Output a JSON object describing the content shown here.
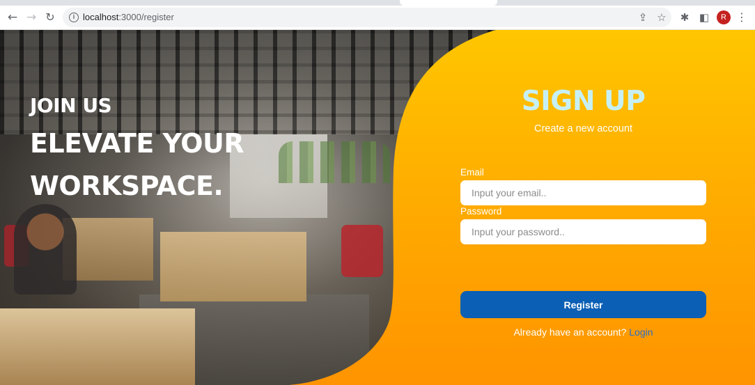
{
  "browser": {
    "url_host": "localhost",
    "url_path": ":3000/register",
    "profile_initial": "R",
    "icons": {
      "back": "back-arrow-icon",
      "forward": "forward-arrow-icon",
      "reload": "reload-icon",
      "site_info": "info-icon",
      "share": "share-icon",
      "bookmark": "star-icon",
      "extensions": "puzzle-icon",
      "side_panel": "side-panel-icon",
      "menu": "kebab-menu-icon"
    }
  },
  "hero": {
    "join": "JOIN US",
    "line1": "ELEVATE YOUR",
    "line2": "WORKSPACE."
  },
  "form": {
    "title": "SIGN UP",
    "subtitle": "Create a new account",
    "email_label": "Email",
    "email_placeholder": "Input your email..",
    "email_value": "",
    "password_label": "Password",
    "password_placeholder": "Input your password..",
    "password_value": "",
    "register_label": "Register",
    "login_prompt": "Already have an account?",
    "login_link": "Login"
  },
  "colors": {
    "panel_top": "#ffc600",
    "panel_bottom": "#ff9a00",
    "title": "#c7f0f5",
    "button": "#0b5fb5",
    "link": "#2a6fc9",
    "avatar": "#c5221f"
  }
}
